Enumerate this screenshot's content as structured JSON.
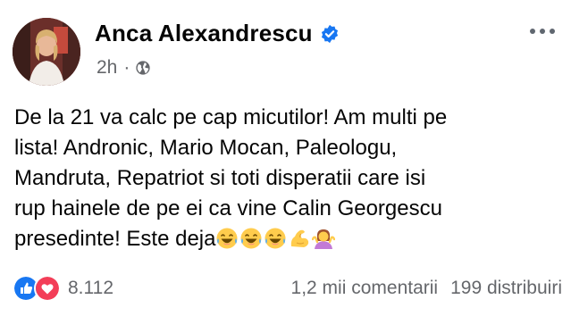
{
  "post": {
    "author": "Anca Alexandrescu",
    "time": "2h",
    "separator": "·",
    "text_lines": [
      "De la 21 va calc pe cap micutilor! Am multi pe",
      "lista! Andronic, Mario Mocan, Paleologu,",
      "Mandruta, Repatriot si toti disperatii care isi",
      "rup hainele de pe ei ca vine Calin Georgescu",
      "presedinte! Este deja"
    ],
    "trailing_emojis": [
      "laughing-crying-emoji",
      "laughing-crying-emoji",
      "laughing-crying-emoji",
      "flexed-biceps-emoji",
      "shrugging-woman-emoji"
    ]
  },
  "footer": {
    "reaction_count": "8.112",
    "comments": "1,2 mii comentarii",
    "shares": "199 distribuiri"
  },
  "colors": {
    "like_blue": "#1877f2",
    "love_red": "#f33e58",
    "meta_gray": "#65676b",
    "emoji_yellow": "#ffcc4d"
  }
}
